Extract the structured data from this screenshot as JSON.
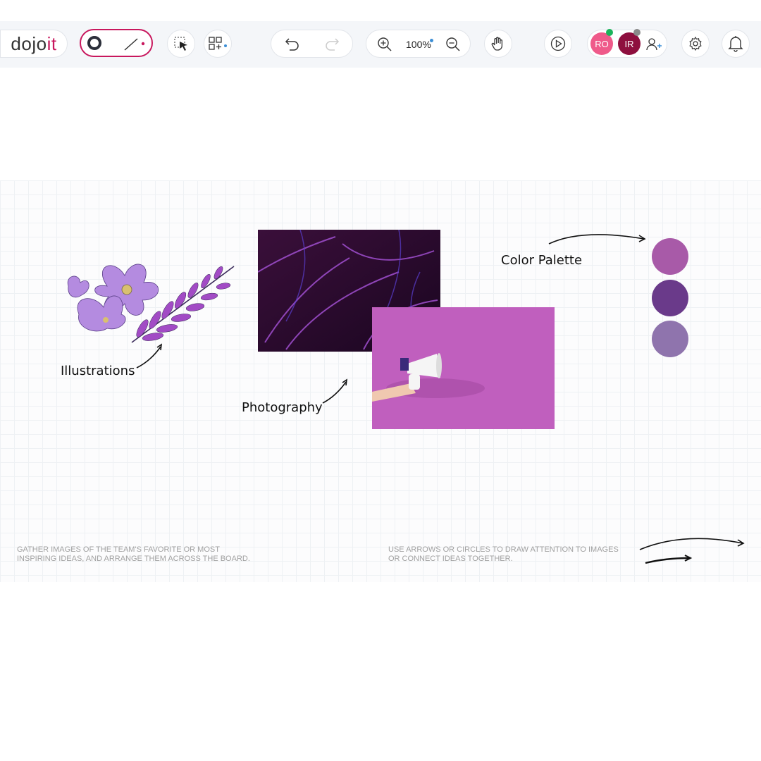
{
  "app": {
    "logo_prefix": "dojo",
    "logo_suffix": "it"
  },
  "toolbar": {
    "zoom_value": "100%",
    "icons": [
      "color-ring-icon",
      "line-tool-icon",
      "select-area-icon",
      "add-widget-icon",
      "undo-icon",
      "redo-icon",
      "zoom-in-icon",
      "zoom-out-icon",
      "hand-icon",
      "play-icon",
      "add-user-icon",
      "gear-icon",
      "bell-icon"
    ],
    "users": [
      {
        "initials": "RO",
        "color": "#ef5a8a",
        "status": "#1bb35a"
      },
      {
        "initials": "IR",
        "color": "#8e0f3e",
        "status": "#8a8a8a"
      }
    ],
    "accent": "#c8175d"
  },
  "board": {
    "labels": {
      "illustrations": "Illustrations",
      "photography": "Photography",
      "color_palette": "Color Palette"
    },
    "palette": [
      "#a85aa8",
      "#6a3a8a",
      "#8f74ad"
    ],
    "notes": {
      "left": "GATHER IMAGES OF THE TEAM'S FAVORITE OR MOST INSPIRING IDEAS, AND ARRANGE THEM ACROSS THE BOARD.",
      "right": "USE ARROWS OR CIRCLES TO DRAW ATTENTION TO IMAGES OR CONNECT IDEAS TOGETHER."
    }
  }
}
